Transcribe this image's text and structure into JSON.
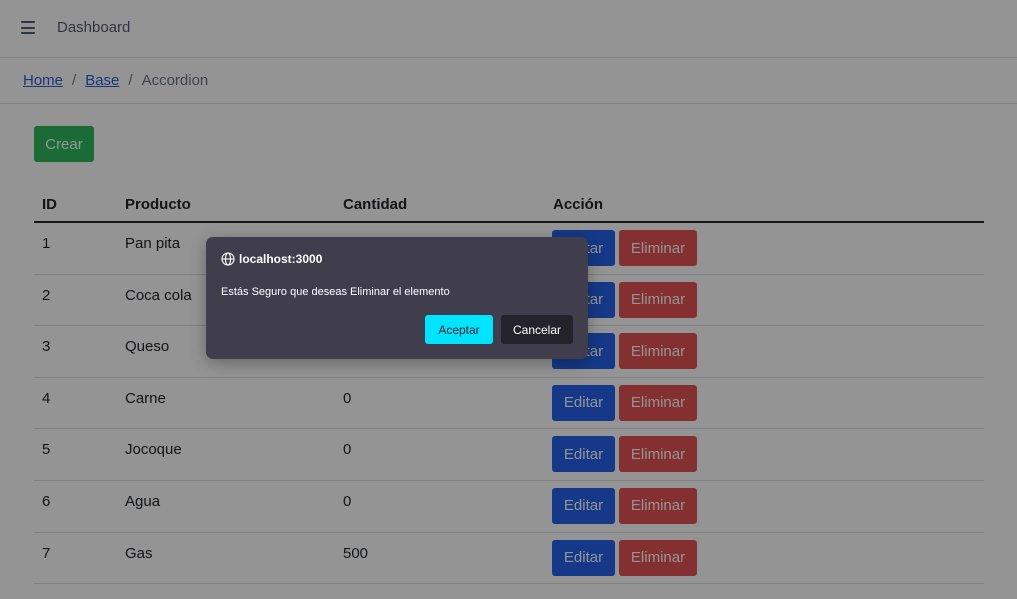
{
  "header": {
    "title": "Dashboard"
  },
  "breadcrumb": {
    "home": "Home",
    "base": "Base",
    "current": "Accordion",
    "separator": "/"
  },
  "actions": {
    "crear_label": "Crear"
  },
  "table": {
    "headers": {
      "id": "ID",
      "producto": "Producto",
      "cantidad": "Cantidad",
      "accion": "Acción"
    },
    "rows": [
      {
        "id": "1",
        "producto": "Pan pita",
        "cantidad": ""
      },
      {
        "id": "2",
        "producto": "Coca cola",
        "cantidad": ""
      },
      {
        "id": "3",
        "producto": "Queso",
        "cantidad": ""
      },
      {
        "id": "4",
        "producto": "Carne",
        "cantidad": "0"
      },
      {
        "id": "5",
        "producto": "Jocoque",
        "cantidad": "0"
      },
      {
        "id": "6",
        "producto": "Agua",
        "cantidad": "0"
      },
      {
        "id": "7",
        "producto": "Gas",
        "cantidad": "500"
      }
    ],
    "editar_label": "Editar",
    "eliminar_label": "Eliminar"
  },
  "dialog": {
    "origin": "localhost:3000",
    "message": "Estás Seguro que deseas Eliminar el elemento",
    "accept_label": "Aceptar",
    "cancel_label": "Cancelar",
    "icon": "globe-icon"
  },
  "colors": {
    "success": "#2eb85c",
    "primary": "#2563eb",
    "danger": "#e55353",
    "dialog_bg": "#403e4c",
    "accept": "#00e5ff"
  }
}
